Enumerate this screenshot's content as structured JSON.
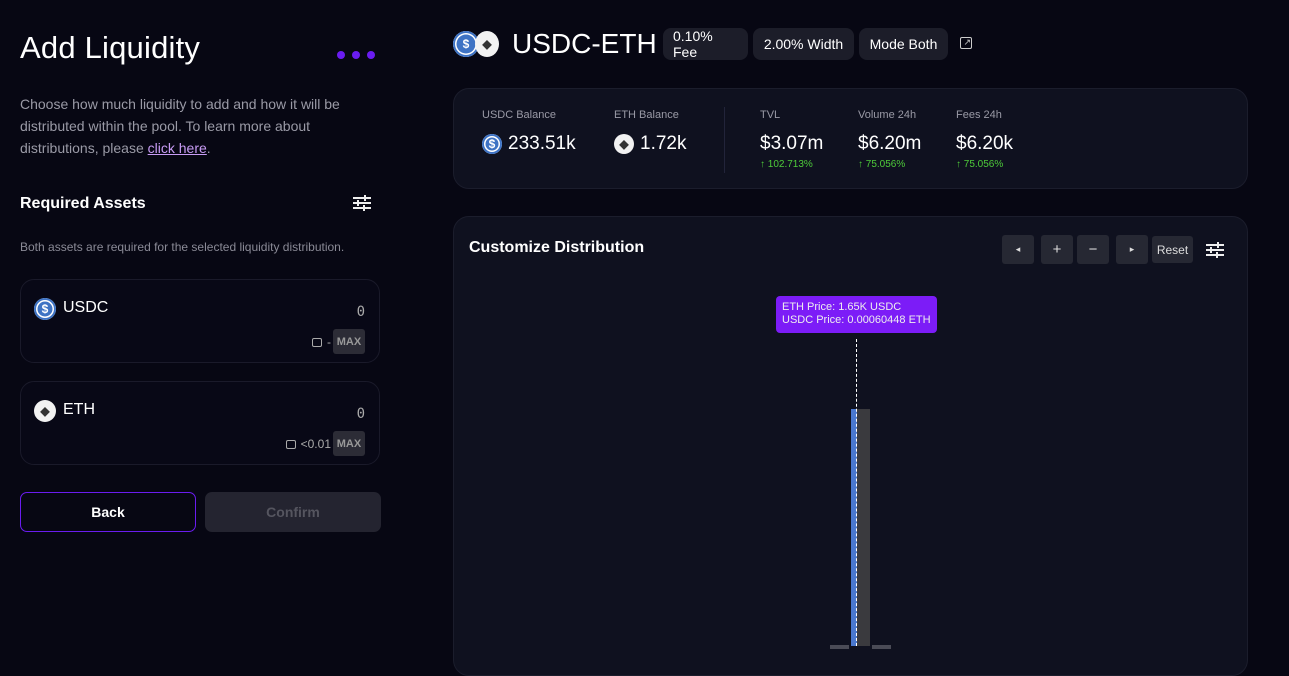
{
  "left": {
    "title": "Add Liquidity",
    "description": "Choose how much liquidity to add and how it will be distributed within the pool. To learn more about distributions, please ",
    "link": "click here",
    "desc_end": ".",
    "required_title": "Required Assets",
    "required_sub": "Both assets are required for the selected liquidity distribution.",
    "assets": [
      {
        "symbol": "USDC",
        "value": "0",
        "balance": "-",
        "max": "MAX",
        "icon": "usdc-icon"
      },
      {
        "symbol": "ETH",
        "value": "0",
        "balance": "<0.01",
        "max": "MAX",
        "icon": "eth-icon"
      }
    ],
    "back": "Back",
    "confirm": "Confirm"
  },
  "pool": {
    "pair": "USDC-ETH",
    "fee": "0.10% Fee",
    "width": "2.00% Width",
    "mode": "Mode Both"
  },
  "stats": {
    "usdc_balance": {
      "label": "USDC Balance",
      "value": "233.51k"
    },
    "eth_balance": {
      "label": "ETH Balance",
      "value": "1.72k"
    },
    "tvl": {
      "label": "TVL",
      "value": "$3.07m",
      "change": "102.713%"
    },
    "volume": {
      "label": "Volume 24h",
      "value": "$6.20m",
      "change": "75.056%"
    },
    "fees": {
      "label": "Fees 24h",
      "value": "$6.20k",
      "change": "75.056%"
    }
  },
  "distribution": {
    "title": "Customize Distribution",
    "controls": {
      "left": "◂",
      "plus": "+",
      "minus": "−",
      "right": "▸",
      "reset": "Reset"
    },
    "tooltip": {
      "line1": "ETH Price:  1.65K USDC",
      "line2": "USDC Price:  0.00060448 ETH"
    }
  },
  "colors": {
    "accent": "#6a1cf0",
    "tooltip": "#7c1cf7",
    "positive": "#4ecb3a",
    "usdc": "#3e73c4"
  }
}
